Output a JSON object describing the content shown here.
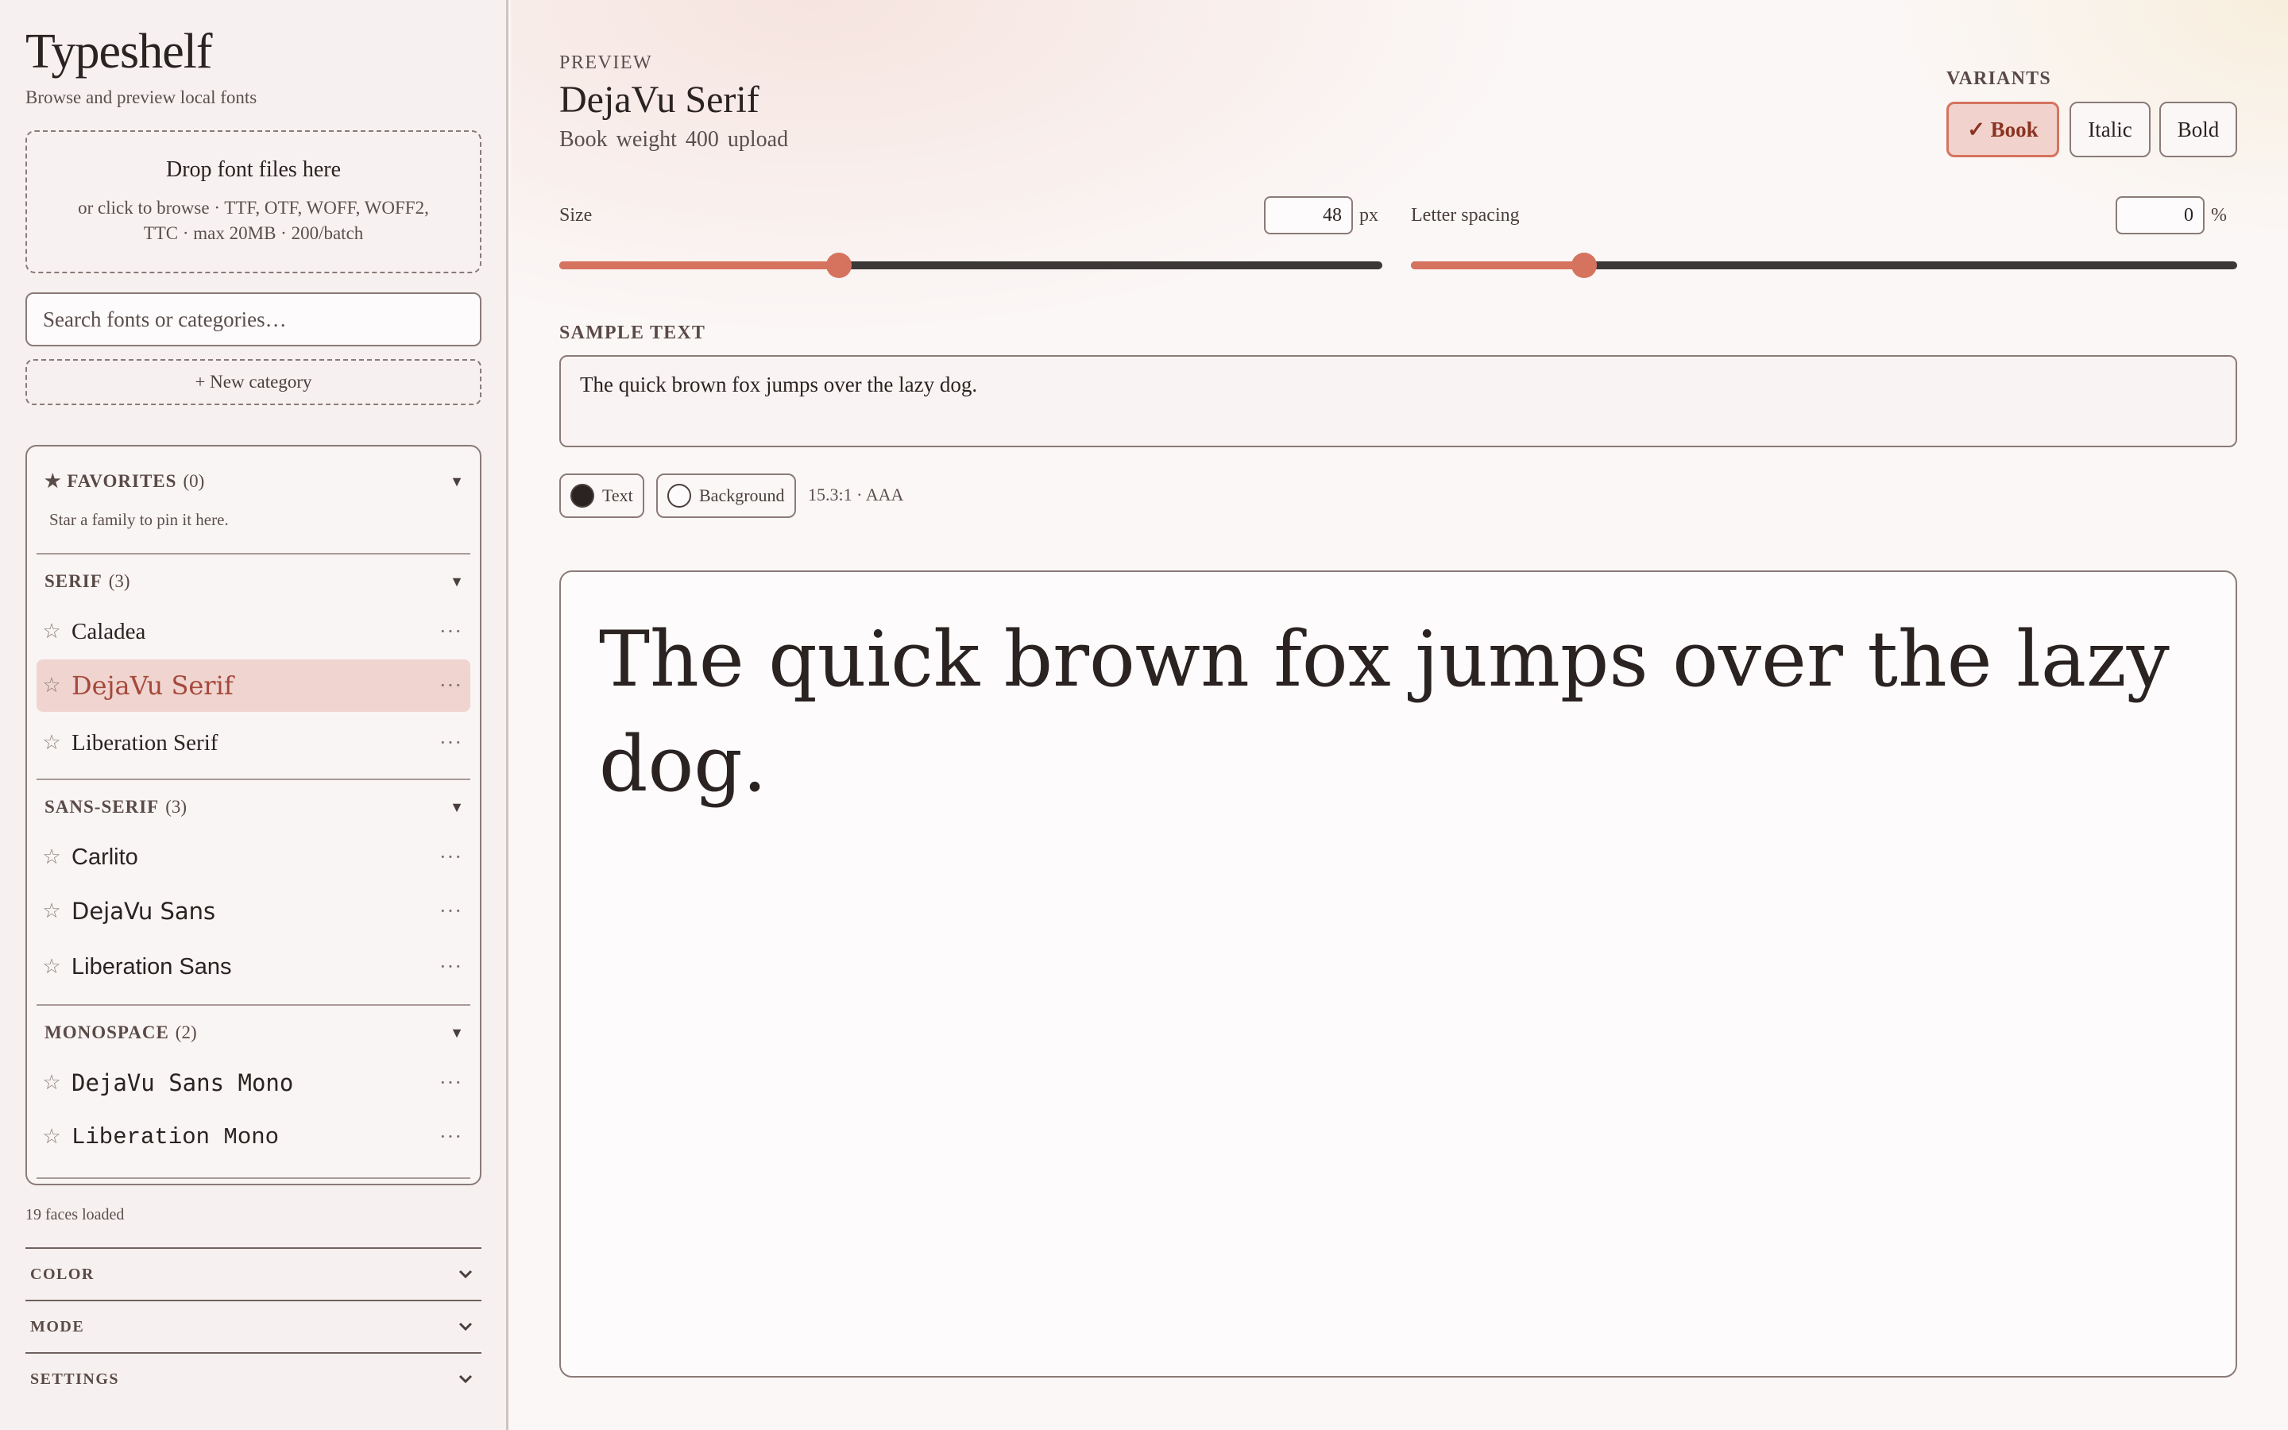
{
  "sidebar": {
    "app_title": "Typeshelf",
    "app_subtitle": "Browse and preview local fonts",
    "dropzone": {
      "title": "Drop font files here",
      "subtitle": "or click to browse · TTF, OTF, WOFF, WOFF2, TTC · max 20MB · 200/batch"
    },
    "search_placeholder": "Search fonts or categories…",
    "new_category_label": "+ New category",
    "groups": {
      "favorites": {
        "name": "★ FAVORITES",
        "count": "(0)",
        "note": "Star a family to pin it here."
      },
      "serif": {
        "name": "SERIF",
        "count": "(3)",
        "items": [
          "Caladea",
          "DejaVu Serif",
          "Liberation Serif"
        ]
      },
      "sans": {
        "name": "SANS-SERIF",
        "count": "(3)",
        "items": [
          "Carlito",
          "DejaVu Sans",
          "Liberation Sans"
        ]
      },
      "mono": {
        "name": "MONOSPACE",
        "count": "(2)",
        "items": [
          "DejaVu Sans Mono",
          "Liberation Mono"
        ]
      }
    },
    "selected_font": "DejaVu Serif",
    "faces_loaded": "19 faces loaded",
    "sections": [
      "COLOR",
      "MODE",
      "SETTINGS"
    ]
  },
  "main": {
    "eyebrow": "PREVIEW",
    "font_name": "DejaVu Serif",
    "meta": "Book  weight 400  upload",
    "variants_label": "VARIANTS",
    "variants": [
      "✓ Book",
      "Italic",
      "Bold"
    ],
    "active_variant": "Book",
    "size": {
      "label": "Size",
      "value": "48",
      "unit": "px",
      "fraction": 0.34
    },
    "spacing": {
      "label": "Letter spacing",
      "value": "0",
      "unit": "%",
      "fraction": 0.21
    },
    "sample_label": "SAMPLE TEXT",
    "sample_text": "The quick brown fox jumps over the lazy dog.",
    "text_chip": "Text",
    "background_chip": "Background",
    "text_color": "#2a2322",
    "background_color": "#fdfbfb",
    "contrast": "15.3:1 · AAA"
  },
  "colors": {
    "accent": "#d6735f",
    "selected_bg": "#f0d4d0"
  }
}
